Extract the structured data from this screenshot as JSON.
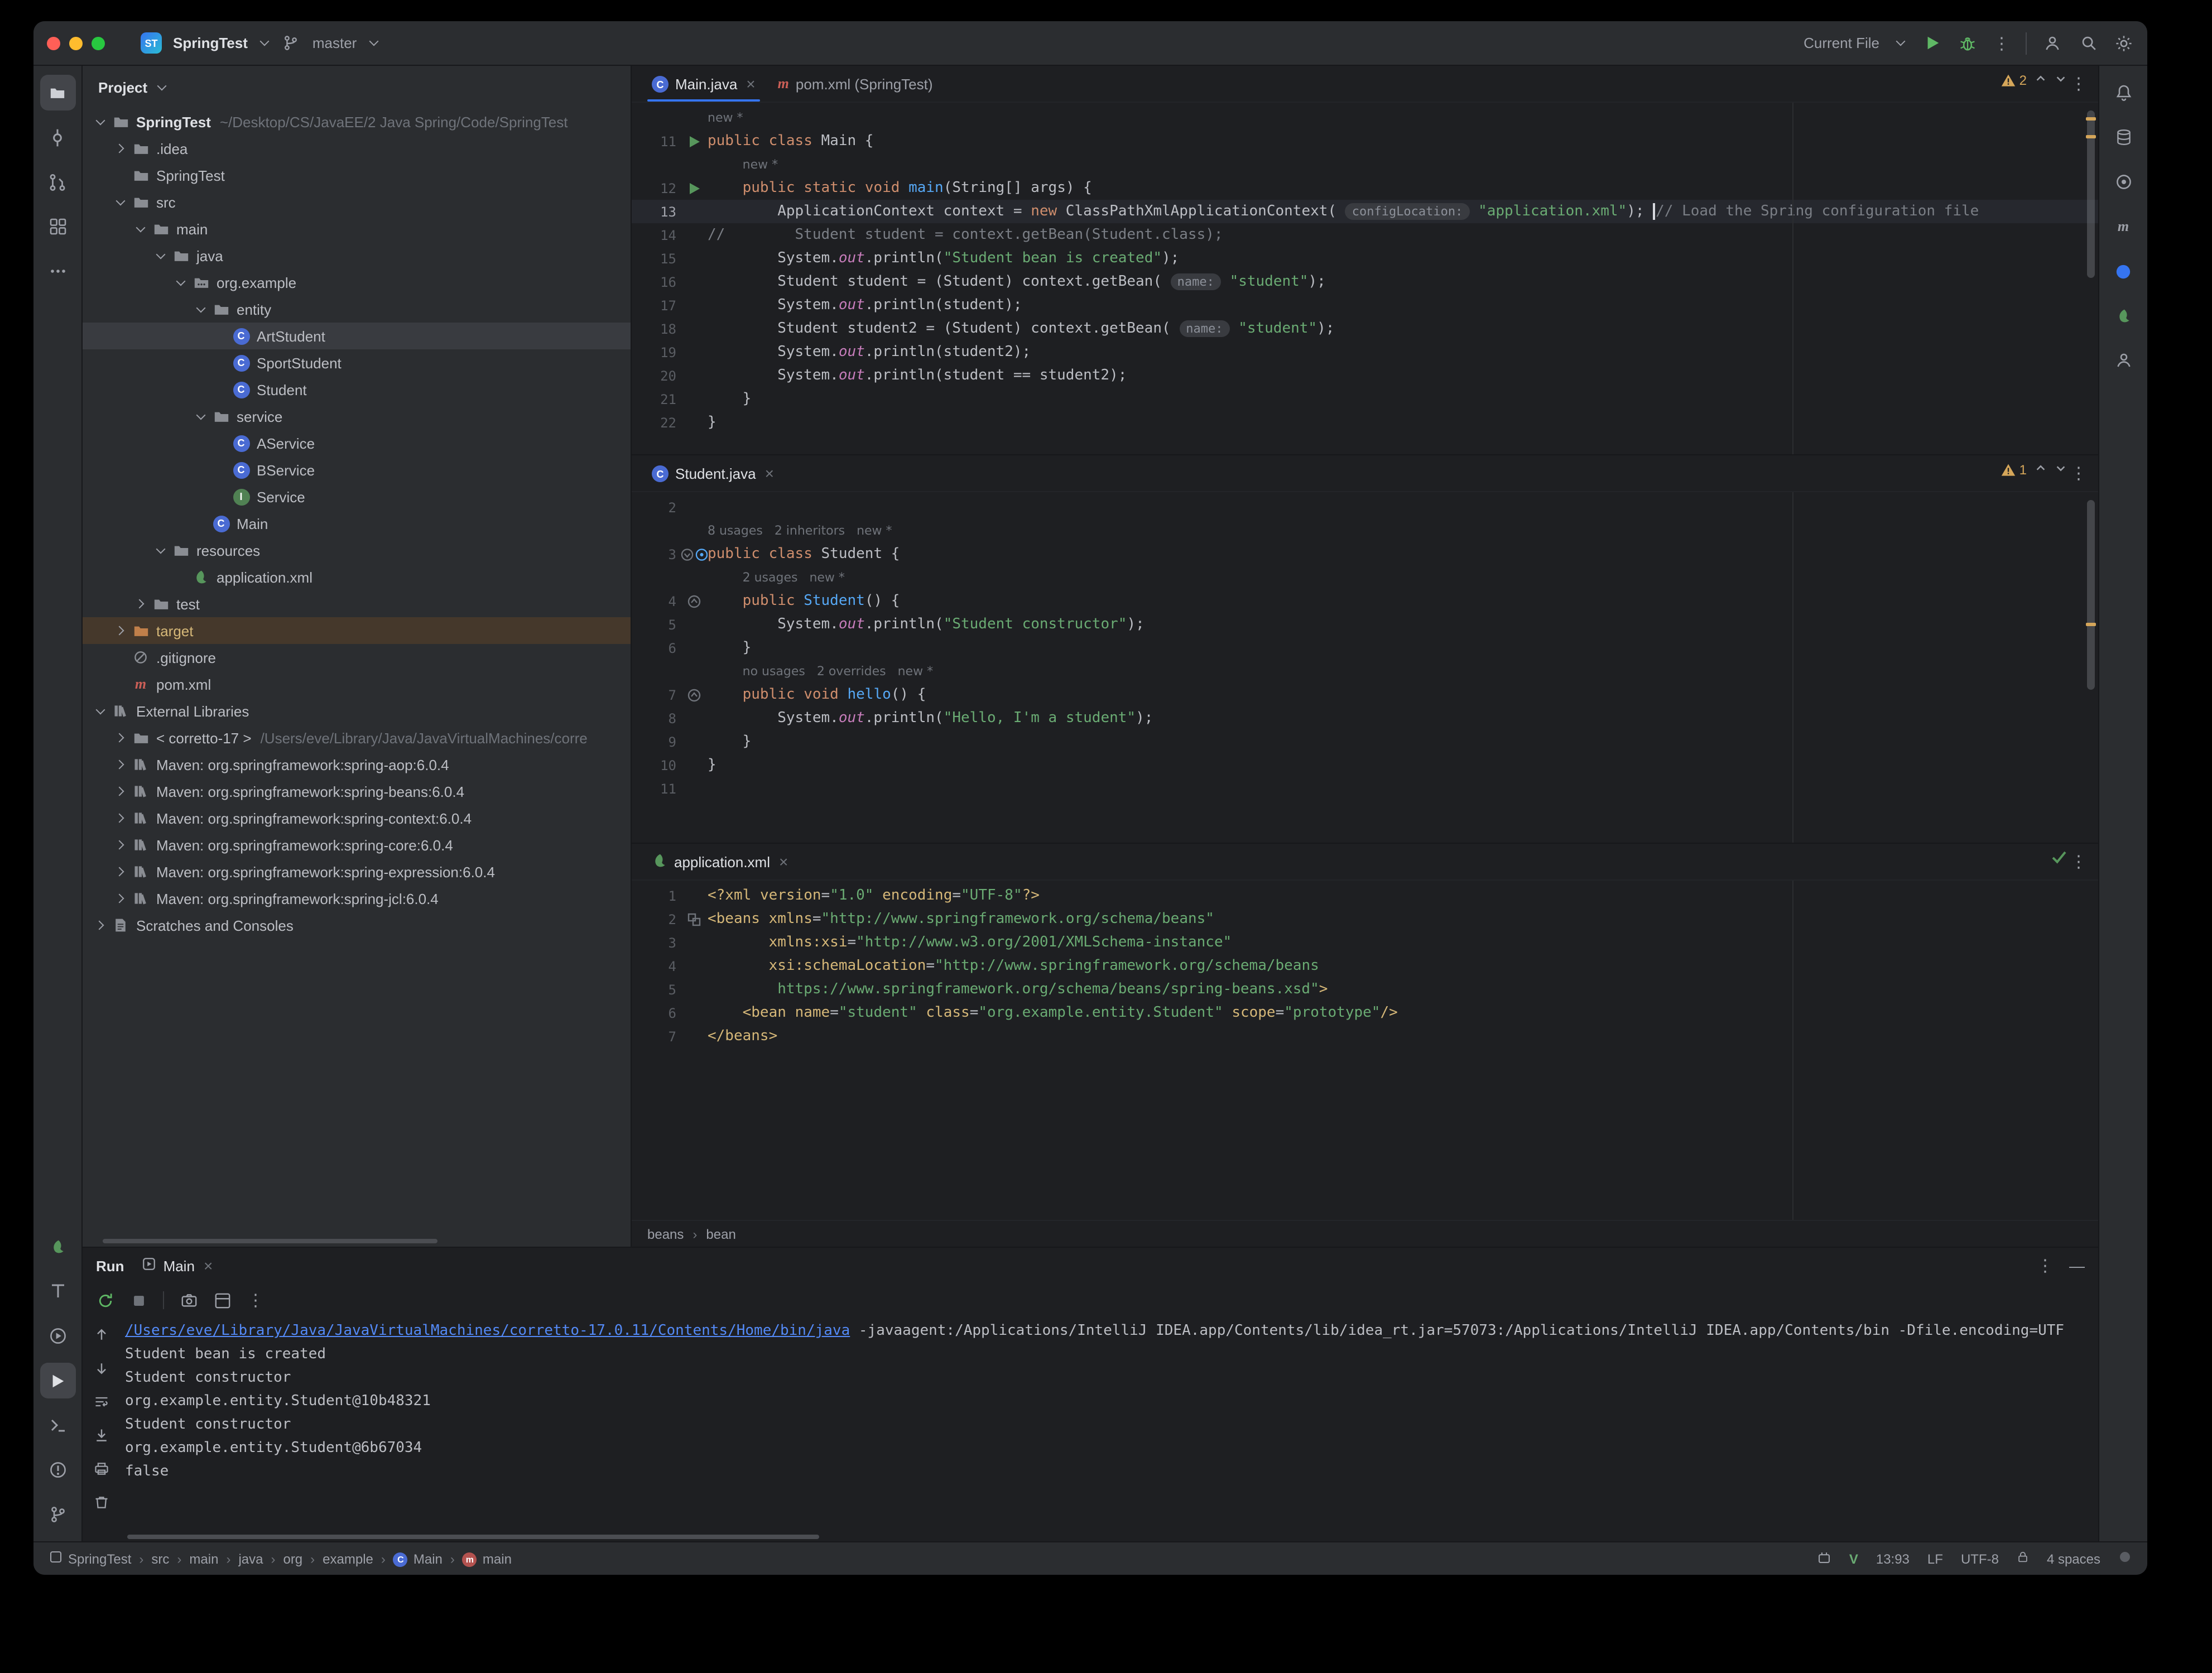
{
  "titlebar": {
    "app_badge": "ST",
    "project_name": "SpringTest",
    "branch": "master",
    "run_config": "Current File"
  },
  "left_toolbar": {
    "top": [
      "project",
      "commit",
      "pull-requests",
      "structure",
      "more"
    ],
    "bottom": [
      "spring-boot",
      "todo",
      "services",
      "run",
      "terminal",
      "problems",
      "git-branch"
    ],
    "active": [
      "project",
      "run"
    ]
  },
  "right_toolbar": {
    "top": [
      "notifications",
      "database",
      "gradle",
      "maven",
      "ai-assistant",
      "spring",
      "profiler"
    ]
  },
  "project_panel": {
    "header": "Project",
    "tree": [
      {
        "label": "SpringTest",
        "suffix": "~/Desktop/CS/JavaEE/2 Java Spring/Code/SpringTest",
        "icon": "folder",
        "chev": "open",
        "level": 0,
        "bold": true
      },
      {
        "label": ".idea",
        "icon": "folder",
        "chev": "closed",
        "level": 1
      },
      {
        "label": "SpringTest",
        "icon": "folder",
        "chev": "none",
        "level": 1
      },
      {
        "label": "src",
        "icon": "folder",
        "chev": "open",
        "level": 1
      },
      {
        "label": "main",
        "icon": "folder",
        "chev": "open",
        "level": 2
      },
      {
        "label": "java",
        "icon": "folder",
        "chev": "open",
        "level": 3
      },
      {
        "label": "org.example",
        "icon": "package",
        "chev": "open",
        "level": 4
      },
      {
        "label": "entity",
        "icon": "folder",
        "chev": "open",
        "level": 5
      },
      {
        "label": "ArtStudent",
        "icon": "class",
        "chev": "none",
        "level": 6,
        "selected": true
      },
      {
        "label": "SportStudent",
        "icon": "class",
        "chev": "none",
        "level": 6
      },
      {
        "label": "Student",
        "icon": "class",
        "chev": "none",
        "level": 6
      },
      {
        "label": "service",
        "icon": "folder",
        "chev": "open",
        "level": 5
      },
      {
        "label": "AService",
        "icon": "class",
        "chev": "none",
        "level": 6
      },
      {
        "label": "BService",
        "icon": "class",
        "chev": "none",
        "level": 6
      },
      {
        "label": "Service",
        "icon": "interface",
        "chev": "none",
        "level": 6
      },
      {
        "label": "Main",
        "icon": "class",
        "chev": "none",
        "level": 5
      },
      {
        "label": "resources",
        "icon": "folder",
        "chev": "open",
        "level": 3
      },
      {
        "label": "application.xml",
        "icon": "spring",
        "chev": "none",
        "level": 4
      },
      {
        "label": "test",
        "icon": "folder",
        "chev": "closed",
        "level": 2
      },
      {
        "label": "target",
        "icon": "folder-excluded",
        "chev": "closed",
        "level": 1,
        "excluded": true
      },
      {
        "label": ".gitignore",
        "icon": "git",
        "chev": "none",
        "level": 1
      },
      {
        "label": "pom.xml",
        "icon": "maven",
        "chev": "none",
        "level": 1
      },
      {
        "label": "External Libraries",
        "icon": "library",
        "chev": "open",
        "level": 0
      },
      {
        "label": "< corretto-17 >",
        "suffix": "/Users/eve/Library/Java/JavaVirtualMachines/corre",
        "icon": "folder",
        "chev": "closed",
        "level": 1
      },
      {
        "label": "Maven: org.springframework:spring-aop:6.0.4",
        "icon": "library",
        "chev": "closed",
        "level": 1
      },
      {
        "label": "Maven: org.springframework:spring-beans:6.0.4",
        "icon": "library",
        "chev": "closed",
        "level": 1
      },
      {
        "label": "Maven: org.springframework:spring-context:6.0.4",
        "icon": "library",
        "chev": "closed",
        "level": 1
      },
      {
        "label": "Maven: org.springframework:spring-core:6.0.4",
        "icon": "library",
        "chev": "closed",
        "level": 1
      },
      {
        "label": "Maven: org.springframework:spring-expression:6.0.4",
        "icon": "library",
        "chev": "closed",
        "level": 1
      },
      {
        "label": "Maven: org.springframework:spring-jcl:6.0.4",
        "icon": "library",
        "chev": "closed",
        "level": 1
      },
      {
        "label": "Scratches and Consoles",
        "icon": "scratch",
        "chev": "closed",
        "level": 0
      }
    ]
  },
  "editors": [
    {
      "focused": true,
      "tabs": [
        {
          "label": "Main.java",
          "icon": "class",
          "active": true,
          "close": true
        },
        {
          "label": "pom.xml (SpringTest)",
          "icon": "maven",
          "active": false,
          "close": false
        }
      ],
      "badge": {
        "warnings": "2"
      },
      "lines": [
        {
          "hint": "new *",
          "ind": 0
        },
        {
          "num": "11",
          "gutter": "run",
          "tokens": [
            [
              "k",
              "public"
            ],
            [
              "d",
              " "
            ],
            [
              "k",
              "class"
            ],
            [
              "d",
              " Main {"
            ]
          ]
        },
        {
          "hint": "new *",
          "ind": 1
        },
        {
          "num": "12",
          "gutter": "run",
          "tokens": [
            [
              "d",
              "    "
            ],
            [
              "k",
              "public"
            ],
            [
              "d",
              " "
            ],
            [
              "k",
              "static"
            ],
            [
              "d",
              " "
            ],
            [
              "k",
              "void"
            ],
            [
              "d",
              " "
            ],
            [
              "m",
              "main"
            ],
            [
              "d",
              "(String[] args) {"
            ]
          ]
        },
        {
          "num": "13",
          "current": true,
          "tokens": [
            [
              "d",
              "        ApplicationContext context = "
            ],
            [
              "k",
              "new"
            ],
            [
              "d",
              " ClassPathXmlApplicationContext( "
            ],
            [
              "p",
              "configLocation:"
            ],
            [
              "d",
              " "
            ],
            [
              "s",
              "\"application.xml\""
            ],
            [
              "d",
              "); "
            ],
            [
              "caret",
              ""
            ],
            [
              "c",
              "// Load the Spring configuration file"
            ]
          ]
        },
        {
          "num": "14",
          "tokens": [
            [
              "c",
              "//        Student student = context.getBean(Student.class);"
            ]
          ]
        },
        {
          "num": "15",
          "tokens": [
            [
              "d",
              "        System."
            ],
            [
              "f",
              "out"
            ],
            [
              "d",
              ".println("
            ],
            [
              "s",
              "\"Student bean is created\""
            ],
            [
              "d",
              ");"
            ]
          ]
        },
        {
          "num": "16",
          "tokens": [
            [
              "d",
              "        Student student = (Student) context.getBean( "
            ],
            [
              "p",
              "name:"
            ],
            [
              "d",
              " "
            ],
            [
              "s",
              "\"student\""
            ],
            [
              "d",
              ");"
            ]
          ]
        },
        {
          "num": "17",
          "tokens": [
            [
              "d",
              "        System."
            ],
            [
              "f",
              "out"
            ],
            [
              "d",
              ".println(student);"
            ]
          ]
        },
        {
          "num": "18",
          "tokens": [
            [
              "d",
              "        Student student2 = (Student) context.getBean( "
            ],
            [
              "p",
              "name:"
            ],
            [
              "d",
              " "
            ],
            [
              "s",
              "\"student\""
            ],
            [
              "d",
              ");"
            ]
          ]
        },
        {
          "num": "19",
          "tokens": [
            [
              "d",
              "        System."
            ],
            [
              "f",
              "out"
            ],
            [
              "d",
              ".println(student2);"
            ]
          ]
        },
        {
          "num": "20",
          "tokens": [
            [
              "d",
              "        System."
            ],
            [
              "f",
              "out"
            ],
            [
              "d",
              ".println(student == student2);"
            ]
          ]
        },
        {
          "num": "21",
          "tokens": [
            [
              "d",
              "    }"
            ]
          ]
        },
        {
          "num": "22",
          "tokens": [
            [
              "d",
              "}"
            ]
          ]
        }
      ]
    },
    {
      "focused": false,
      "tabs": [
        {
          "label": "Student.java",
          "icon": "class",
          "active": true,
          "close": true
        }
      ],
      "badge": {
        "warnings": "1"
      },
      "lines": [
        {
          "num": "2",
          "tokens": []
        },
        {
          "hint": "8 usages   2 inheritors   new *",
          "ind": 0
        },
        {
          "num": "3",
          "gutter": "impl",
          "tokens": [
            [
              "k",
              "public"
            ],
            [
              "d",
              " "
            ],
            [
              "k",
              "class"
            ],
            [
              "d",
              " Student {"
            ]
          ]
        },
        {
          "hint": "2 usages   new *",
          "ind": 1
        },
        {
          "num": "4",
          "gutter": "mark",
          "tokens": [
            [
              "d",
              "    "
            ],
            [
              "k",
              "public"
            ],
            [
              "d",
              " "
            ],
            [
              "m",
              "Student"
            ],
            [
              "d",
              "() {"
            ]
          ]
        },
        {
          "num": "5",
          "tokens": [
            [
              "d",
              "        System."
            ],
            [
              "f",
              "out"
            ],
            [
              "d",
              ".println("
            ],
            [
              "s",
              "\"Student constructor\""
            ],
            [
              "d",
              ");"
            ]
          ]
        },
        {
          "num": "6",
          "tokens": [
            [
              "d",
              "    }"
            ]
          ]
        },
        {
          "hint": "no usages   2 overrides   new *",
          "ind": 1
        },
        {
          "num": "7",
          "gutter": "mark",
          "tokens": [
            [
              "d",
              "    "
            ],
            [
              "k",
              "public"
            ],
            [
              "d",
              " "
            ],
            [
              "k",
              "void"
            ],
            [
              "d",
              " "
            ],
            [
              "m",
              "hello"
            ],
            [
              "d",
              "() {"
            ]
          ]
        },
        {
          "num": "8",
          "tokens": [
            [
              "d",
              "        System."
            ],
            [
              "f",
              "out"
            ],
            [
              "d",
              ".println("
            ],
            [
              "s",
              "\"Hello, I'm a student\""
            ],
            [
              "d",
              ");"
            ]
          ]
        },
        {
          "num": "9",
          "tokens": [
            [
              "d",
              "    }"
            ]
          ]
        },
        {
          "num": "10",
          "tokens": [
            [
              "d",
              "}"
            ]
          ]
        },
        {
          "num": "11",
          "tokens": []
        }
      ]
    },
    {
      "focused": false,
      "tabs": [
        {
          "label": "application.xml",
          "icon": "spring",
          "active": true,
          "close": true
        }
      ],
      "badge": {
        "ok": true
      },
      "breadcrumb": [
        "beans",
        "bean"
      ],
      "lines": [
        {
          "num": "1",
          "tokens": [
            [
              "t",
              "<?xml "
            ],
            [
              "t",
              "version"
            ],
            [
              "d",
              "="
            ],
            [
              "s",
              "\"1.0\""
            ],
            [
              "d",
              " "
            ],
            [
              "t",
              "encoding"
            ],
            [
              "d",
              "="
            ],
            [
              "s",
              "\"UTF-8\""
            ],
            [
              "t",
              "?>"
            ]
          ]
        },
        {
          "num": "2",
          "gutter": "ns",
          "tokens": [
            [
              "t",
              "<beans"
            ],
            [
              "d",
              " "
            ],
            [
              "t",
              "xmlns"
            ],
            [
              "d",
              "="
            ],
            [
              "s",
              "\"http://www.springframework.org/schema/beans\""
            ]
          ]
        },
        {
          "num": "3",
          "tokens": [
            [
              "d",
              "       "
            ],
            [
              "t",
              "xmlns:xsi"
            ],
            [
              "d",
              "="
            ],
            [
              "s",
              "\"http://www.w3.org/2001/XMLSchema-instance\""
            ]
          ]
        },
        {
          "num": "4",
          "tokens": [
            [
              "d",
              "       "
            ],
            [
              "t",
              "xsi:schemaLocation"
            ],
            [
              "d",
              "="
            ],
            [
              "s",
              "\"http://www.springframework.org/schema/beans"
            ]
          ]
        },
        {
          "num": "5",
          "tokens": [
            [
              "s",
              "        https://www.springframework.org/schema/beans/spring-beans.xsd\""
            ],
            [
              "t",
              ">"
            ]
          ]
        },
        {
          "num": "6",
          "tokens": [
            [
              "d",
              "    "
            ],
            [
              "t",
              "<bean"
            ],
            [
              "d",
              " "
            ],
            [
              "t",
              "name"
            ],
            [
              "d",
              "="
            ],
            [
              "s",
              "\"student\""
            ],
            [
              "d",
              " "
            ],
            [
              "t",
              "class"
            ],
            [
              "d",
              "="
            ],
            [
              "s",
              "\"org.example.entity.Student\""
            ],
            [
              "d",
              " "
            ],
            [
              "t",
              "scope"
            ],
            [
              "d",
              "="
            ],
            [
              "s",
              "\"prototype\""
            ],
            [
              "t",
              "/>"
            ]
          ]
        },
        {
          "num": "7",
          "tokens": [
            [
              "t",
              "</beans>"
            ]
          ]
        }
      ]
    }
  ],
  "run_panel": {
    "title": "Run",
    "tab": "Main",
    "console": [
      {
        "tokens": [
          [
            "link",
            "/Users/eve/Library/Java/JavaVirtualMachines/corretto-17.0.11/Contents/Home/bin/java"
          ],
          [
            "d",
            " -javaagent:/Applications/IntelliJ IDEA.app/Contents/lib/idea_rt.jar=57073:/Applications/IntelliJ IDEA.app/Contents/bin -Dfile.encoding=UTF"
          ]
        ]
      },
      {
        "tokens": [
          [
            "d",
            "Student bean is created"
          ]
        ]
      },
      {
        "tokens": [
          [
            "d",
            "Student constructor"
          ]
        ]
      },
      {
        "tokens": [
          [
            "d",
            "org.example.entity.Student@10b48321"
          ]
        ]
      },
      {
        "tokens": [
          [
            "d",
            "Student constructor"
          ]
        ]
      },
      {
        "tokens": [
          [
            "d",
            "org.example.entity.Student@6b67034"
          ]
        ]
      },
      {
        "tokens": [
          [
            "d",
            "false"
          ]
        ]
      }
    ]
  },
  "status_bar": {
    "breadcrumbs": [
      {
        "label": "SpringTest",
        "icon": "window"
      },
      {
        "label": "src"
      },
      {
        "label": "main"
      },
      {
        "label": "java"
      },
      {
        "label": "org"
      },
      {
        "label": "example"
      },
      {
        "label": "Main",
        "icon": "class"
      },
      {
        "label": "main",
        "icon": "method"
      }
    ],
    "right": [
      {
        "icon": "plugin"
      },
      {
        "icon": "vim",
        "label": "V"
      },
      {
        "label": "13:93"
      },
      {
        "label": "LF"
      },
      {
        "label": "UTF-8"
      },
      {
        "icon": "lock"
      },
      {
        "label": "4 spaces"
      },
      {
        "icon": "dot"
      }
    ]
  }
}
